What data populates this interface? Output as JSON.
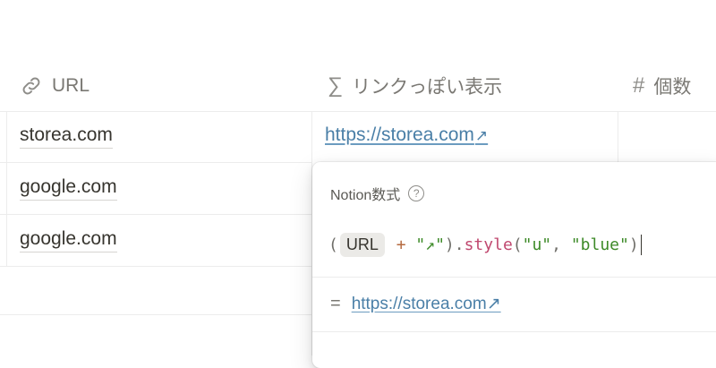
{
  "columns": {
    "url": {
      "label": "URL",
      "icon": "link-icon"
    },
    "link_display": {
      "label": "リンクっぽい表示",
      "icon": "sigma-icon"
    },
    "count": {
      "label": "個数",
      "icon": "hash-icon"
    }
  },
  "rows": [
    {
      "url": "storea.com",
      "link_display": "https://storea.com",
      "link_arrow": "↗"
    },
    {
      "url": "google.com"
    },
    {
      "url": "google.com"
    }
  ],
  "formula_popup": {
    "title": "Notion数式",
    "help_glyph": "?",
    "formula": {
      "open_paren": "(",
      "property_chip": "URL",
      "plus": "+",
      "string_literal": "\"↗\"",
      "close_paren_dot": ").",
      "function_name": "style",
      "args_open": "(",
      "arg1": "\"u\"",
      "comma": ", ",
      "arg2": "\"blue\"",
      "args_close": ")"
    },
    "result_equals": "=",
    "result_text": "https://storea.com↗"
  },
  "colors": {
    "link_blue": "#4a7fa7",
    "string_green": "#3d8a28",
    "function_pink": "#c0486f",
    "operator_orange": "#b56a3f"
  }
}
